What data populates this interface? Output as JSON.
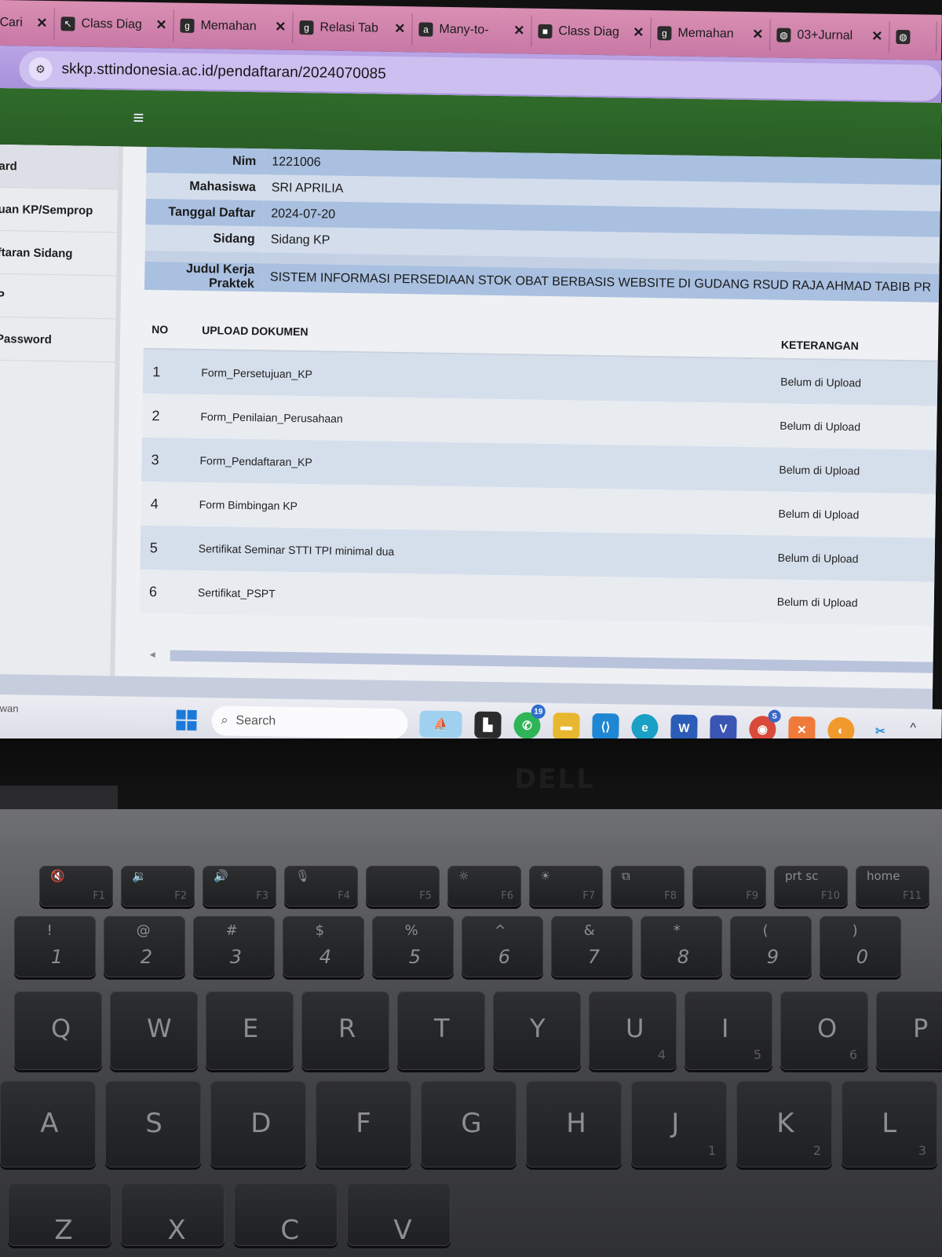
{
  "browser": {
    "tabs": [
      {
        "label": "Cari",
        "icon": ""
      },
      {
        "label": "Class Diag",
        "icon": "cursor"
      },
      {
        "label": "Memahan",
        "icon": "g"
      },
      {
        "label": "Relasi Tab",
        "icon": "g"
      },
      {
        "label": "Many-to-",
        "icon": "a"
      },
      {
        "label": "Class Diag",
        "icon": ""
      },
      {
        "label": "Memahan",
        "icon": "g"
      },
      {
        "label": "03+Jurnal",
        "icon": "globe"
      }
    ],
    "close_glyph": "✕",
    "url": "skkp.sttindonesia.ac.id/pendaftaran/2024070085"
  },
  "sidebar": {
    "items": [
      {
        "label": "ard"
      },
      {
        "label": "uan KP/Semprop"
      },
      {
        "label": "ftaran Sidang"
      },
      {
        "label": "P"
      },
      {
        "label": "Password"
      }
    ]
  },
  "info": {
    "rows": [
      {
        "label": "Nim",
        "value": "1221006"
      },
      {
        "label": "Mahasiswa",
        "value": "SRI APRILIA"
      },
      {
        "label": "Tanggal Daftar",
        "value": "2024-07-20"
      },
      {
        "label": "Sidang",
        "value": "Sidang KP"
      }
    ],
    "judul_label": "Judul Kerja Praktek",
    "judul_value": "SISTEM INFORMASI PERSEDIAAN STOK OBAT BERBASIS WEBSITE DI GUDANG RSUD RAJA AHMAD TABIB PR"
  },
  "upload": {
    "headers": {
      "no": "NO",
      "doc": "UPLOAD DOKUMEN",
      "ket": "KETERANGAN"
    },
    "rows": [
      {
        "no": "1",
        "doc": "Form_Persetujuan_KP",
        "ket": "Belum di Upload"
      },
      {
        "no": "2",
        "doc": "Form_Penilaian_Perusahaan",
        "ket": "Belum di Upload"
      },
      {
        "no": "3",
        "doc": "Form_Pendaftaran_KP",
        "ket": "Belum di Upload"
      },
      {
        "no": "4",
        "doc": "Form Bimbingan KP",
        "ket": "Belum di Upload"
      },
      {
        "no": "5",
        "doc": "Sertifikat Seminar STTI TPI minimal dua",
        "ket": "Belum di Upload"
      },
      {
        "no": "6",
        "doc": "Sertifikat_PSPT",
        "ket": "Belum di Upload"
      }
    ]
  },
  "taskbar": {
    "side_text": "wan",
    "search_placeholder": "Search",
    "whatsapp_badge": "19",
    "chrome_badge": "S",
    "icons": [
      "boat-icon",
      "file-explorer-dark-icon",
      "whatsapp-icon",
      "folder-icon",
      "vscode-icon",
      "edge-icon",
      "word-icon",
      "visio-icon",
      "chrome-icon",
      "xampp-icon",
      "firefox-icon",
      "snipping-tool-icon"
    ],
    "chevron": "^"
  },
  "laptop": {
    "brand": "DELL",
    "fn_row": [
      {
        "icon": "🔇",
        "label": "F1"
      },
      {
        "icon": "🔉",
        "label": "F2"
      },
      {
        "icon": "🔊",
        "label": "F3"
      },
      {
        "icon": "🎙",
        "label": "F4"
      },
      {
        "icon": "",
        "label": "F5"
      },
      {
        "icon": "☼",
        "label": "F6"
      },
      {
        "icon": "☀",
        "label": "F7"
      },
      {
        "icon": "⧉",
        "label": "F8"
      },
      {
        "icon": "",
        "label": "F9"
      },
      {
        "icon": "prt sc",
        "label": "F10"
      },
      {
        "icon": "home",
        "label": "F11"
      }
    ],
    "num_row": [
      {
        "top": "!",
        "main": "1"
      },
      {
        "top": "@",
        "main": "2"
      },
      {
        "top": "#",
        "main": "3"
      },
      {
        "top": "$",
        "main": "4"
      },
      {
        "top": "%",
        "main": "5"
      },
      {
        "top": "^",
        "main": "6"
      },
      {
        "top": "&",
        "main": "7"
      },
      {
        "top": "*",
        "main": "8"
      },
      {
        "top": "(",
        "main": "9"
      },
      {
        "top": ")",
        "main": "0"
      }
    ],
    "q_row": [
      {
        "main": "Q",
        "sub": ""
      },
      {
        "main": "W",
        "sub": ""
      },
      {
        "main": "E",
        "sub": ""
      },
      {
        "main": "R",
        "sub": ""
      },
      {
        "main": "T",
        "sub": ""
      },
      {
        "main": "Y",
        "sub": ""
      },
      {
        "main": "U",
        "sub": "4"
      },
      {
        "main": "I",
        "sub": "5"
      },
      {
        "main": "O",
        "sub": "6"
      },
      {
        "main": "P",
        "sub": ""
      }
    ],
    "a_row": [
      {
        "main": "A",
        "sub": ""
      },
      {
        "main": "S",
        "sub": ""
      },
      {
        "main": "D",
        "sub": ""
      },
      {
        "main": "F",
        "sub": ""
      },
      {
        "main": "G",
        "sub": ""
      },
      {
        "main": "H",
        "sub": ""
      },
      {
        "main": "J",
        "sub": "1"
      },
      {
        "main": "K",
        "sub": "2"
      },
      {
        "main": "L",
        "sub": "3"
      }
    ],
    "z_row": [
      {
        "main": "Z"
      },
      {
        "main": "X"
      },
      {
        "main": "C"
      },
      {
        "main": "V"
      }
    ]
  }
}
